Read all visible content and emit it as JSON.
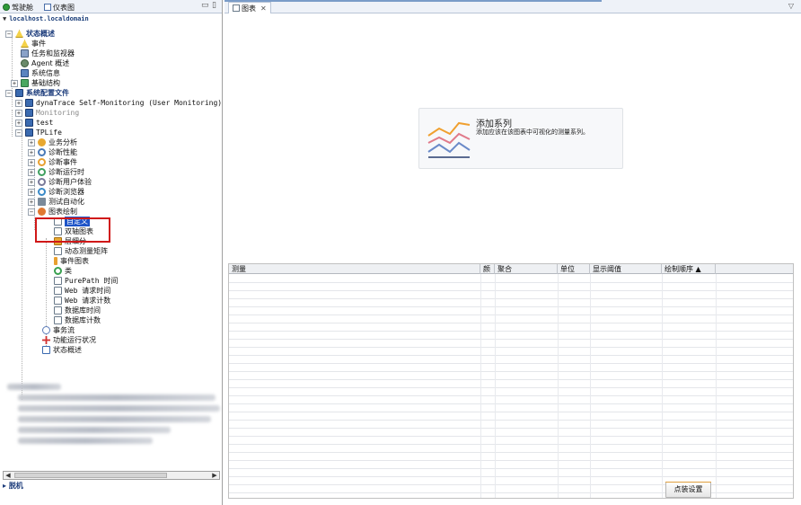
{
  "left_panel": {
    "tabs": [
      {
        "label": "驾驶舱",
        "icon": "cockpit-icon"
      },
      {
        "label": "仪表图",
        "icon": "dashboard-icon"
      }
    ],
    "host": "localhost.localdomain",
    "tree": {
      "status_overview": "状态概述",
      "events": "事件",
      "tasks_monitors": "任务和监视器",
      "agent_overview": "Agent 概述",
      "system_info": "系统信息",
      "infrastructure": "基础结构",
      "system_profiles": "系统配置文件",
      "profile_selfmon": "dynaTrace Self-Monitoring (User Monitoring)",
      "profile_monitoring": "Monitoring",
      "profile_test": "test",
      "profile_tplife": "TPLife",
      "business_analysis": "业务分析",
      "diag_performance": "诊断性能",
      "diag_events": "诊断事件",
      "diag_runtime": "诊断运行时",
      "diag_user_experience": "诊断用户体验",
      "diag_browser": "诊断浏览器",
      "test_automation": "测试自动化",
      "charting": "图表绘制",
      "custom": "自定义",
      "dual_axis": "双轴图表",
      "layer_breakdown": "层细分",
      "dynamic_matrix": "动态测量矩阵",
      "event_chart": "事件图表",
      "classes": "类",
      "purepath_time": "PurePath 时间",
      "web_request_time": "Web 请求时间",
      "web_request_count": "Web 请求计数",
      "db_time": "数据库时间",
      "db_count": "数据库计数",
      "transaction_flow": "事务流",
      "functional_health": "功能运行状况",
      "status_overview2": "状态概述"
    },
    "offline": "脱机"
  },
  "right_panel": {
    "tab_label": "图表",
    "tab_close": "✕",
    "menu_arrow": "▽",
    "add_series": {
      "title": "添加系列",
      "description": "添加应该在该图表中可视化的测量系列。"
    },
    "table": {
      "columns": [
        "测量",
        "颜",
        "聚合",
        "单位",
        "显示阈值",
        "绘制顺序 ▲"
      ]
    },
    "settings_button": "点装设置"
  }
}
